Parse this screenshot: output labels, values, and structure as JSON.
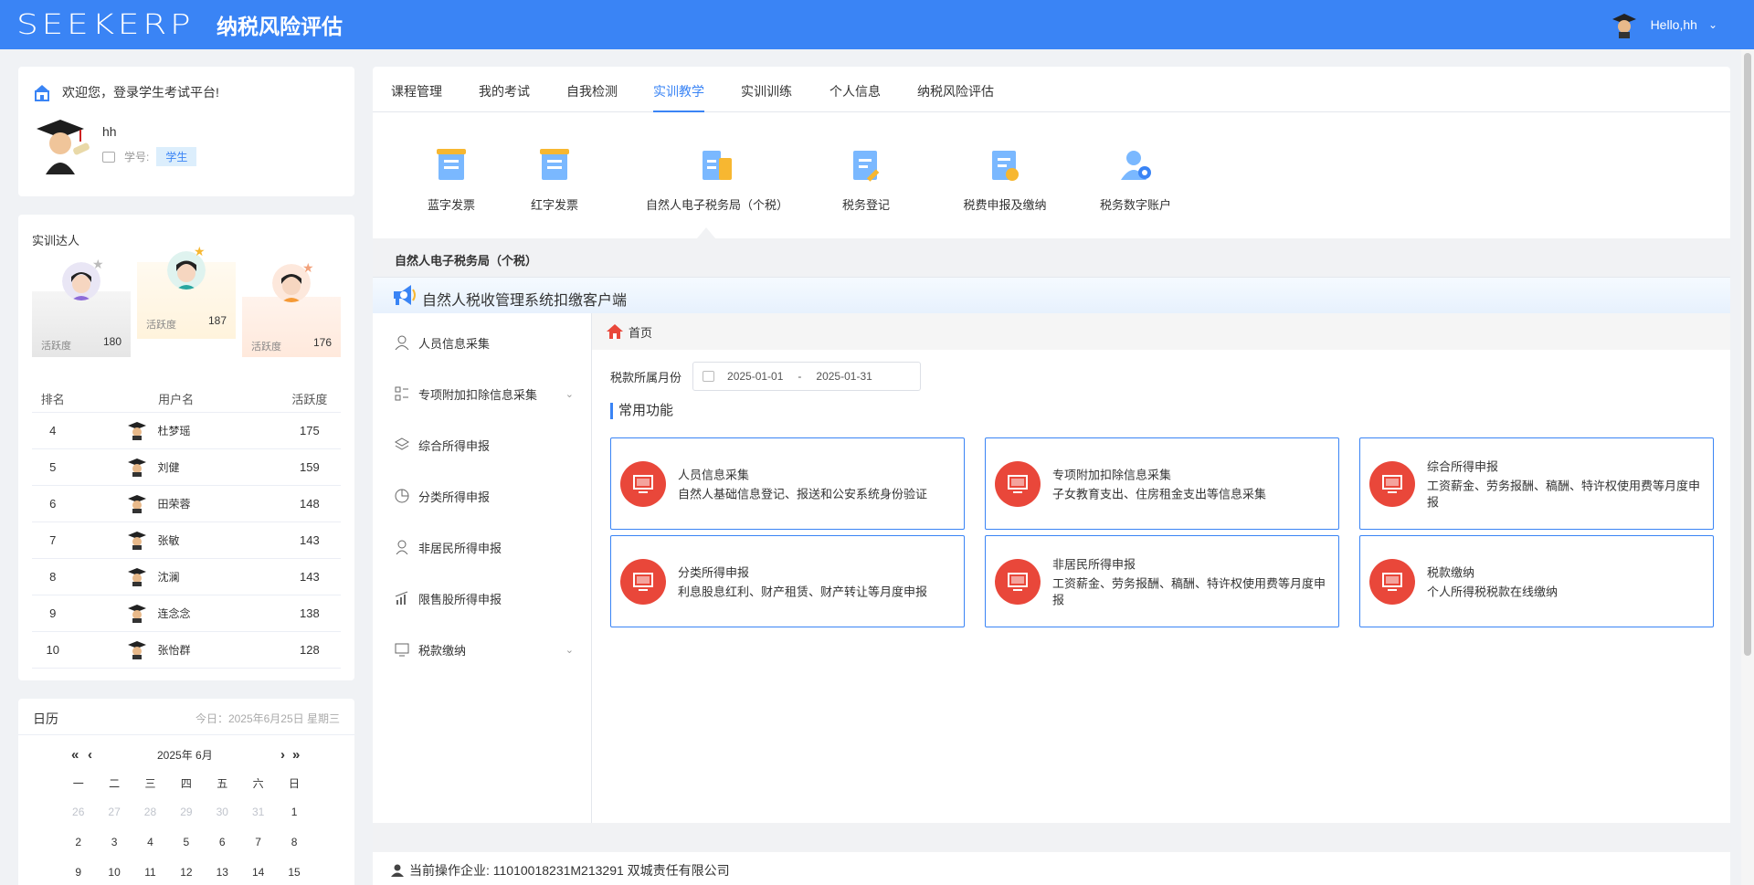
{
  "header": {
    "logo": "SEEKERP",
    "title": "纳税风险评估",
    "greeting": "Hello,hh"
  },
  "welcome": {
    "text": "欢迎您，登录学生考试平台!",
    "username": "hh",
    "id_label": "学号:",
    "role": "学生"
  },
  "ranking": {
    "title": "实训达人",
    "podium": [
      {
        "activity_label": "活跃度",
        "value": "180"
      },
      {
        "activity_label": "活跃度",
        "value": "187"
      },
      {
        "activity_label": "活跃度",
        "value": "176"
      }
    ],
    "columns": [
      "排名",
      "用户名",
      "活跃度"
    ],
    "rows": [
      {
        "rank": "4",
        "name": "杜梦瑶",
        "score": "175"
      },
      {
        "rank": "5",
        "name": "刘健",
        "score": "159"
      },
      {
        "rank": "6",
        "name": "田荣蓉",
        "score": "148"
      },
      {
        "rank": "7",
        "name": "张敏",
        "score": "143"
      },
      {
        "rank": "8",
        "name": "沈澜",
        "score": "143"
      },
      {
        "rank": "9",
        "name": "连念念",
        "score": "138"
      },
      {
        "rank": "10",
        "name": "张怡群",
        "score": "128"
      }
    ]
  },
  "calendar": {
    "title": "日历",
    "today": "今日：2025年6月25日 星期三",
    "nav": {
      "prev_year": "«",
      "prev_month": "‹",
      "month": "2025年 6月",
      "next_month": "›",
      "next_year": "»"
    },
    "weekdays": [
      "一",
      "二",
      "三",
      "四",
      "五",
      "六",
      "日"
    ],
    "week1": [
      "26",
      "27",
      "28",
      "29",
      "30",
      "31",
      "1"
    ],
    "week2": [
      "2",
      "3",
      "4",
      "5",
      "6",
      "7",
      "8"
    ],
    "week3": [
      "9",
      "10",
      "11",
      "12",
      "13",
      "14",
      "15"
    ]
  },
  "tabs": [
    "课程管理",
    "我的考试",
    "自我检测",
    "实训教学",
    "实训训练",
    "个人信息",
    "纳税风险评估"
  ],
  "tools": [
    "蓝字发票",
    "红字发票",
    "自然人电子税务局（个税）",
    "税务登记",
    "税费申报及缴纳",
    "税务数字账户"
  ],
  "section_title": "自然人电子税务局（个税）",
  "client_title": "自然人税收管理系统扣缴客户端",
  "menu": [
    "人员信息采集",
    "专项附加扣除信息采集",
    "综合所得申报",
    "分类所得申报",
    "非居民所得申报",
    "限售股所得申报",
    "税款缴纳"
  ],
  "breadcrumb": "首页",
  "period": {
    "label": "税款所属月份",
    "start": "2025-01-01",
    "sep": "-",
    "end": "2025-01-31"
  },
  "common_title": "常用功能",
  "functions": [
    {
      "name": "人员信息采集",
      "desc": "自然人基础信息登记、报送和公安系统身份验证"
    },
    {
      "name": "专项附加扣除信息采集",
      "desc": "子女教育支出、住房租金支出等信息采集"
    },
    {
      "name": "综合所得申报",
      "desc": "工资薪金、劳务报酬、稿酬、特许权使用费等月度申报"
    },
    {
      "name": "分类所得申报",
      "desc": "利息股息红利、财产租赁、财产转让等月度申报"
    },
    {
      "name": "非居民所得申报",
      "desc": "工资薪金、劳务报酬、稿酬、特许权使用费等月度申报"
    },
    {
      "name": "税款缴纳",
      "desc": "个人所得税税款在线缴纳"
    }
  ],
  "footer": "当前操作企业: 11010018231M213291 双城责任有限公司"
}
